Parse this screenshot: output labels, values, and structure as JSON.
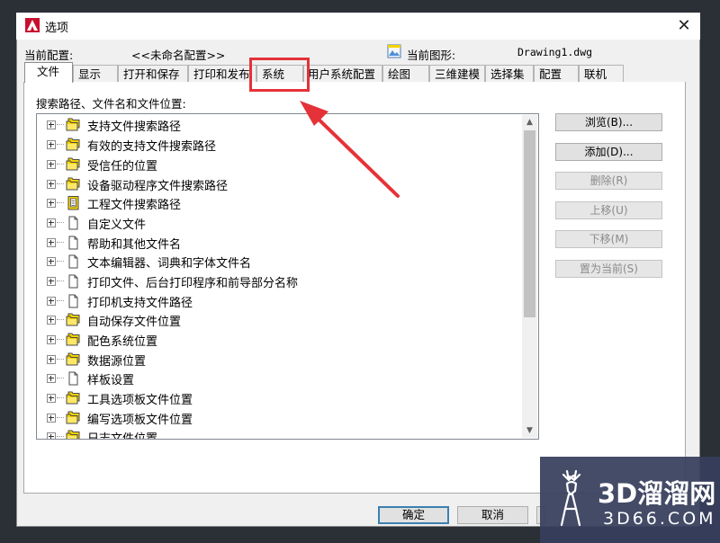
{
  "window": {
    "title": "选项",
    "close_glyph": "✕"
  },
  "header": {
    "current_profile_label": "当前配置:",
    "current_profile_value": "<<未命名配置>>",
    "current_drawing_label": "当前图形:",
    "current_drawing_value": "Drawing1.dwg"
  },
  "tabs": [
    {
      "label": "文件",
      "active": true
    },
    {
      "label": "显示"
    },
    {
      "label": "打开和保存"
    },
    {
      "label": "打印和发布"
    },
    {
      "label": "系统"
    },
    {
      "label": "用户系统配置"
    },
    {
      "label": "绘图"
    },
    {
      "label": "三维建模"
    },
    {
      "label": "选择集"
    },
    {
      "label": "配置"
    },
    {
      "label": "联机"
    }
  ],
  "panel": {
    "section_label": "搜索路径、文件名和文件位置:"
  },
  "tree": {
    "items": [
      {
        "label": "支持文件搜索路径",
        "icon": "folder-stack-icon"
      },
      {
        "label": "有效的支持文件搜索路径",
        "icon": "folder-stack-icon"
      },
      {
        "label": "受信任的位置",
        "icon": "folder-stack-icon"
      },
      {
        "label": "设备驱动程序文件搜索路径",
        "icon": "folder-stack-icon"
      },
      {
        "label": "工程文件搜索路径",
        "icon": "project-file-icon"
      },
      {
        "label": "自定义文件",
        "icon": "document-icon"
      },
      {
        "label": "帮助和其他文件名",
        "icon": "document-icon"
      },
      {
        "label": "文本编辑器、词典和字体文件名",
        "icon": "document-icon"
      },
      {
        "label": "打印文件、后台打印程序和前导部分名称",
        "icon": "document-icon"
      },
      {
        "label": "打印机支持文件路径",
        "icon": "document-icon"
      },
      {
        "label": "自动保存文件位置",
        "icon": "folder-stack-icon"
      },
      {
        "label": "配色系统位置",
        "icon": "folder-stack-icon"
      },
      {
        "label": "数据源位置",
        "icon": "folder-stack-icon"
      },
      {
        "label": "样板设置",
        "icon": "document-icon"
      },
      {
        "label": "工具选项板文件位置",
        "icon": "folder-stack-icon"
      },
      {
        "label": "编写选项板文件位置",
        "icon": "folder-stack-icon"
      },
      {
        "label": "日志文件位置",
        "icon": "folder-stack-icon"
      }
    ]
  },
  "side_buttons": [
    {
      "label": "浏览(B)...",
      "enabled": true
    },
    {
      "label": "添加(D)...",
      "enabled": true
    },
    {
      "label": "删除(R)",
      "enabled": false
    },
    {
      "label": "上移(U)",
      "enabled": false
    },
    {
      "label": "下移(M)",
      "enabled": false
    },
    {
      "label": "置为当前(S)",
      "enabled": false
    }
  ],
  "footer": {
    "ok_label": "确定",
    "cancel_label": "取消"
  },
  "watermark": {
    "brand_text": "3D溜溜网",
    "url_text": "3D66.COM"
  },
  "colors": {
    "highlight_red": "#e53238",
    "folder_yellow": "#f5d300",
    "watermark_bg": "#373e5c"
  }
}
